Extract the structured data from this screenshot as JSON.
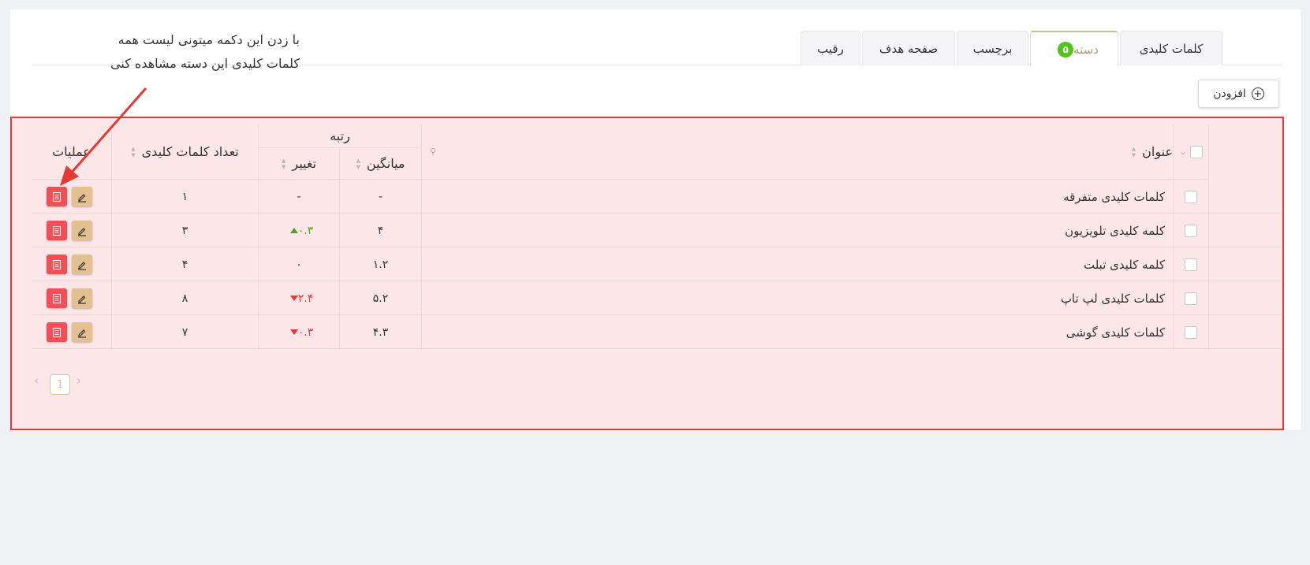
{
  "tabs": [
    {
      "label": "کلمات کلیدی",
      "active": false
    },
    {
      "label": "دسته",
      "active": true,
      "badge": "۵"
    },
    {
      "label": "برچسب",
      "active": false
    },
    {
      "label": "صفحه هدف",
      "active": false
    },
    {
      "label": "رقیب",
      "active": false
    }
  ],
  "toolbar": {
    "add_label": "افزودن"
  },
  "annotation": {
    "line1": "با زدن این دکمه میتونی لیست همه",
    "line2": "کلمات کلیدی این دسته مشاهده کنی"
  },
  "table": {
    "headers": {
      "title": "عنوان",
      "rank": "رتبه",
      "average": "میانگین",
      "change": "تغییر",
      "keyword_count": "تعداد کلمات کلیدی",
      "operations": "عملیات"
    },
    "rows": [
      {
        "title": "کلمات کلیدی متفرقه",
        "average": "-",
        "change": "-",
        "trend": "none",
        "count": "۱"
      },
      {
        "title": "کلمه کلیدی تلویزیون",
        "average": "۴",
        "change": "۰.۳",
        "trend": "up",
        "count": "۳"
      },
      {
        "title": "کلمه کلیدی تبلت",
        "average": "۱.۲",
        "change": "۰",
        "trend": "none",
        "count": "۴"
      },
      {
        "title": "کلمات کلیدی لپ تاپ",
        "average": "۵.۲",
        "change": "۲.۴",
        "trend": "down",
        "count": "۸"
      },
      {
        "title": "کلمات کلیدی گوشی",
        "average": "۴.۳",
        "change": "۰.۳",
        "trend": "down",
        "count": "۷"
      }
    ]
  },
  "pagination": {
    "current": "1"
  },
  "colors": {
    "highlight_border": "#e53935",
    "highlight_fill": "#fce2e4",
    "delete": "#f24e55",
    "edit": "#e3c08f",
    "up": "#52a01a",
    "down": "#e53935",
    "accent": "#52c41a"
  }
}
